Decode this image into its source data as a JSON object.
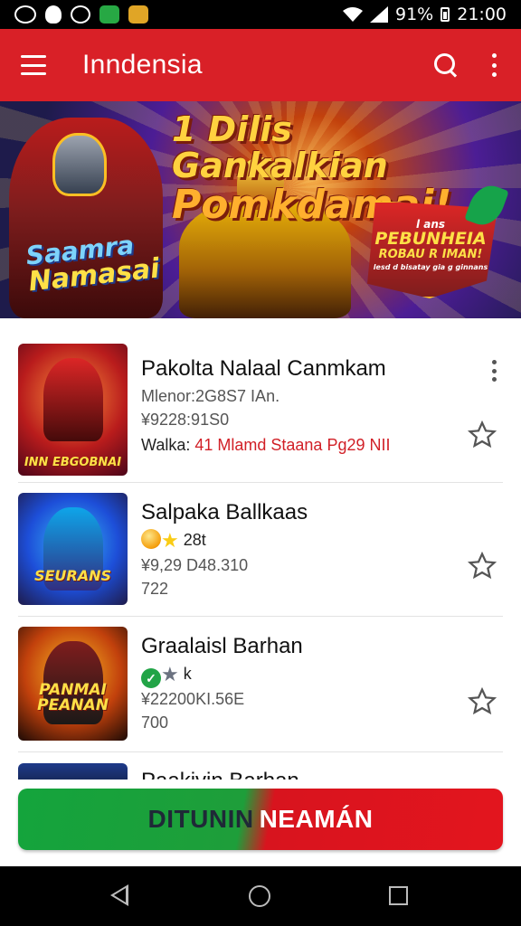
{
  "status_bar": {
    "time": "21:00",
    "battery_text": "91%",
    "icons": [
      "messenger-icon",
      "shield-icon",
      "whatsapp-icon",
      "mail-icon",
      "photo-icon",
      "wifi-icon",
      "signal-icon",
      "battery-icon"
    ]
  },
  "app_bar": {
    "title": "Inndensia",
    "color": "#d92027",
    "icons": [
      "menu-icon",
      "search-icon",
      "more-vert-icon"
    ]
  },
  "banner": {
    "headline_line1": "1 Dilis Gankalkian",
    "headline_line2": "Pomkdamai!",
    "left_line1": "Saamra",
    "left_line2": "Namasai",
    "badge_line1": "l ans",
    "badge_line2": "PEBUNHEIA",
    "badge_line3": "ROBAU R IMAN!",
    "badge_line4": "lesd d bisatay gia g ginnans"
  },
  "list": {
    "items": [
      {
        "title": "Pakolta Nalaal Canmkam",
        "line1": "Mlenor:2G8S7 IAn.",
        "line2": "¥9228:91S0",
        "line3_prefix": "Walka:",
        "line3_red": "41 Mlamd Staana Pg29 NII",
        "thumb_caption": "INN EBGOBNAI"
      },
      {
        "title": "Salpaka Ballkaas",
        "rating_text": "28t",
        "line2": "¥9,29 D48.310",
        "line3": "722",
        "thumb_caption": "SEURANS"
      },
      {
        "title": "Graalaisl Barhan",
        "rating_text": "k",
        "line2": "¥22200KI.56E",
        "line3": "700",
        "thumb_caption": "PANMAI PEANAN"
      },
      {
        "title": "Paakivin Barhan"
      }
    ]
  },
  "cta": {
    "label_part1": "DITUNIN",
    "label_part2": "NEAMÁN",
    "color_left": "#14a43c",
    "color_right": "#e3151e"
  },
  "nav": {
    "icons": [
      "back-icon",
      "home-icon",
      "recents-icon"
    ]
  }
}
